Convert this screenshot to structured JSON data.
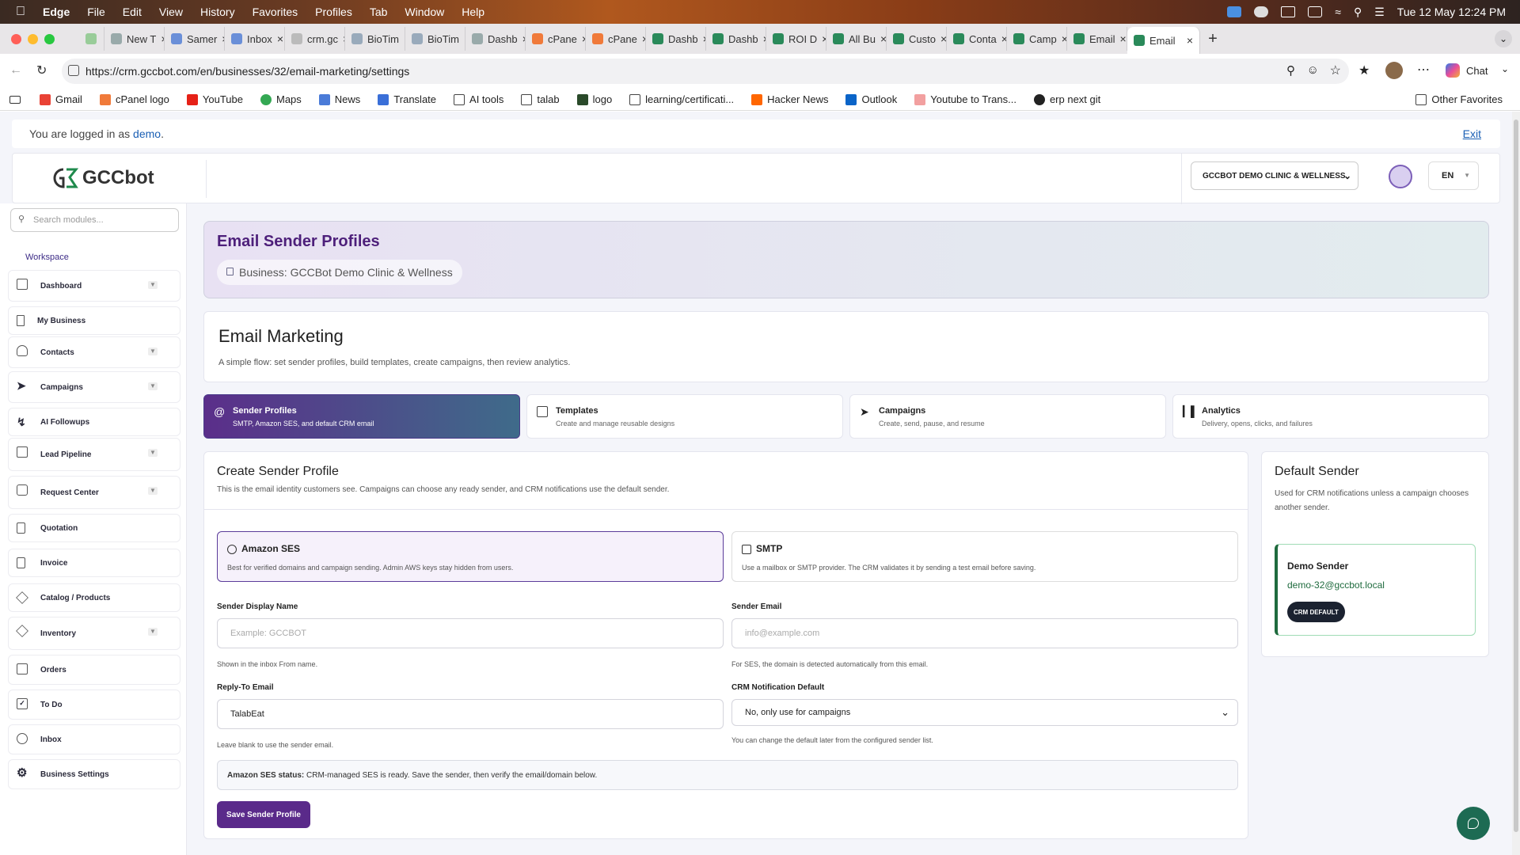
{
  "menubar": {
    "app": "Edge",
    "items": [
      "File",
      "Edit",
      "View",
      "History",
      "Favorites",
      "Profiles",
      "Tab",
      "Window",
      "Help"
    ],
    "datetime": "Tue 12 May  12:24 PM"
  },
  "tabs": [
    {
      "label": "New T"
    },
    {
      "label": "Samer"
    },
    {
      "label": "Inbox"
    },
    {
      "label": "crm.gc"
    },
    {
      "label": "BioTim"
    },
    {
      "label": "BioTim"
    },
    {
      "label": "Dashb"
    },
    {
      "label": "cPane"
    },
    {
      "label": "cPane"
    },
    {
      "label": "Dashb"
    },
    {
      "label": "Dashb"
    },
    {
      "label": "ROI D"
    },
    {
      "label": "All Bu"
    },
    {
      "label": "Custo"
    },
    {
      "label": "Conta"
    },
    {
      "label": "Camp"
    },
    {
      "label": "Email"
    },
    {
      "label": "Email"
    }
  ],
  "address": {
    "url": "https://crm.gccbot.com/en/businesses/32/email-marketing/settings",
    "chat_label": "Chat"
  },
  "bookmarks": {
    "items": [
      "Gmail",
      "cPanel logo",
      "YouTube",
      "Maps",
      "News",
      "Translate",
      "AI tools",
      "talab",
      "logo",
      "learning/certificati...",
      "Hacker News",
      "Outlook",
      "Youtube to Trans...",
      "erp next git"
    ],
    "other": "Other Favorites"
  },
  "login": {
    "prefix": "You are logged in as",
    "user": "demo",
    "suffix": ".",
    "exit": "Exit"
  },
  "header": {
    "logo_text": "GCCbot",
    "business": "GCCBOT DEMO CLINIC & WELLNESS",
    "lang": "EN"
  },
  "sidebar": {
    "search_placeholder": "Search modules...",
    "section": "Workspace",
    "items": [
      {
        "label": "Dashboard"
      },
      {
        "label": "My Business"
      },
      {
        "label": "Contacts"
      },
      {
        "label": "Campaigns"
      },
      {
        "label": "AI Followups"
      },
      {
        "label": "Lead Pipeline"
      },
      {
        "label": "Request Center"
      },
      {
        "label": "Quotation"
      },
      {
        "label": "Invoice"
      },
      {
        "label": "Catalog / Products"
      },
      {
        "label": "Inventory"
      },
      {
        "label": "Orders"
      },
      {
        "label": "To Do"
      },
      {
        "label": "Inbox"
      },
      {
        "label": "Business Settings"
      }
    ]
  },
  "hero": {
    "title": "Email Sender Profiles",
    "business_chip": "Business: GCCBot Demo Clinic & Wellness"
  },
  "email_marketing": {
    "title": "Email Marketing",
    "description": "A simple flow: set sender profiles, build templates, create campaigns, then review analytics."
  },
  "steps": [
    {
      "title": "Sender Profiles",
      "desc": "SMTP, Amazon SES, and default CRM email"
    },
    {
      "title": "Templates",
      "desc": "Create and manage reusable designs"
    },
    {
      "title": "Campaigns",
      "desc": "Create, send, pause, and resume"
    },
    {
      "title": "Analytics",
      "desc": "Delivery, opens, clicks, and failures"
    }
  ],
  "create": {
    "title": "Create Sender Profile",
    "subtitle": "This is the email identity customers see. Campaigns can choose any ready sender, and CRM notifications use the default sender.",
    "types": [
      {
        "title": "Amazon SES",
        "desc": "Best for verified domains and campaign sending. Admin AWS keys stay hidden from users."
      },
      {
        "title": "SMTP",
        "desc": "Use a mailbox or SMTP provider. The CRM validates it by sending a test email before saving."
      }
    ],
    "display_name_label": "Sender Display Name",
    "display_name_placeholder": "Example: GCCBOT",
    "display_name_help": "Shown in the inbox From name.",
    "email_label": "Sender Email",
    "email_placeholder": "info@example.com",
    "email_help": "For SES, the domain is detected automatically from this email.",
    "reply_label": "Reply-To Email",
    "reply_value": "TalabEat",
    "reply_help": "Leave blank to use the sender email.",
    "crm_label": "CRM Notification Default",
    "crm_value": "No, only use for campaigns",
    "crm_help": "You can change the default later from the configured sender list.",
    "status_label": "Amazon SES status:",
    "status_text": "CRM-managed SES is ready. Save the sender, then verify the email/domain below.",
    "save_label": "Save Sender Profile"
  },
  "default_sender": {
    "title": "Default Sender",
    "subtitle": "Used for CRM notifications unless a campaign chooses another sender.",
    "name": "Demo Sender",
    "email": "demo-32@gccbot.local",
    "badge": "CRM DEFAULT"
  }
}
